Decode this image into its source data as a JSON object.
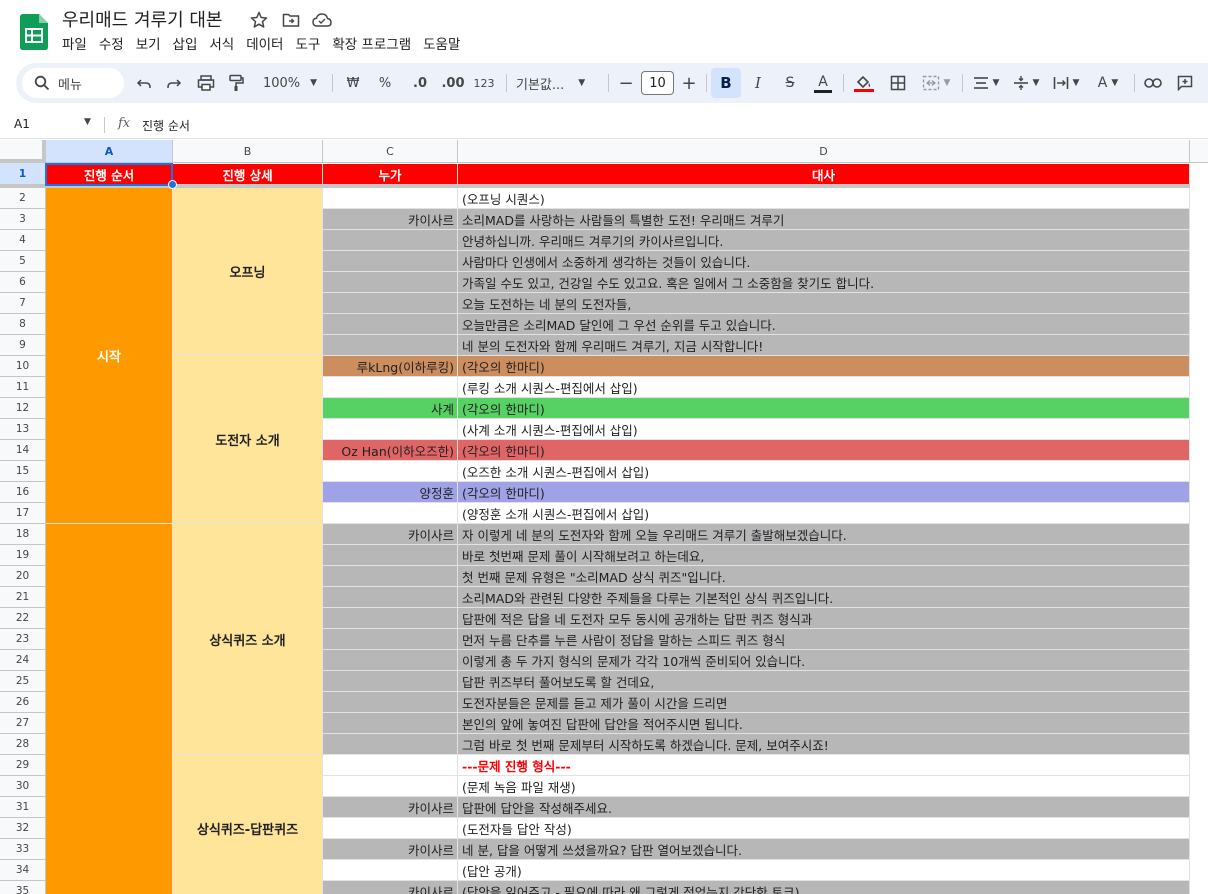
{
  "document": {
    "title": "우리매드 겨루기 대본",
    "menus": [
      "파일",
      "수정",
      "보기",
      "삽입",
      "서식",
      "데이터",
      "도구",
      "확장 프로그램",
      "도움말"
    ]
  },
  "toolbar": {
    "search_label": "메뉴",
    "zoom": "100%",
    "currency": "₩",
    "percent": "%",
    "decimal_decrease": ".0",
    "decimal_increase": ".00",
    "number_format": "123",
    "font_name": "기본값...",
    "font_size": "10",
    "bold": "B",
    "italic": "I",
    "strike": "S",
    "text_color": "A",
    "text_color_hex": "#202124",
    "fill_color_hex": "#ff0000"
  },
  "formula_bar": {
    "name_box": "A1",
    "fx": "fx",
    "content": "진행 순서"
  },
  "colors": {
    "header_red": "#ff0000",
    "section_orange": "#ff9900",
    "detail_yellow": "#ffe599",
    "gray_row": "#b7b7b7",
    "brown_row": "#cc8e5e",
    "green_row": "#57d163",
    "salmon_row": "#e06666",
    "lavender_row": "#9fa2e6",
    "selection_blue": "#1a73e8"
  },
  "sheet": {
    "columns": [
      "A",
      "B",
      "C",
      "D"
    ],
    "header_row": [
      "진행 순서",
      "진행 상세",
      "누가",
      "대사"
    ],
    "merged_a": [
      {
        "label": "시작",
        "rows": [
          2,
          17
        ]
      },
      {
        "label": "",
        "rows": [
          18,
          35
        ]
      }
    ],
    "merged_b": [
      {
        "label": "오프닝",
        "rows": [
          2,
          9
        ]
      },
      {
        "label": "도전자 소개",
        "rows": [
          10,
          17
        ]
      },
      {
        "label": "상식퀴즈 소개",
        "rows": [
          18,
          28
        ]
      },
      {
        "label": "상식퀴즈-답판퀴즈",
        "rows": [
          29,
          35
        ]
      }
    ],
    "rows": [
      {
        "n": "2",
        "who": "",
        "line": "(오프닝 시퀀스)",
        "bg": "white"
      },
      {
        "n": "3",
        "who": "카이사르",
        "line": "소리MAD를 사랑하는 사람들의 특별한 도전! 우리매드 겨루기",
        "bg": "gray"
      },
      {
        "n": "4",
        "who": "",
        "line": "안녕하십니까. 우리매드 겨루기의 카이사르입니다.",
        "bg": "gray"
      },
      {
        "n": "5",
        "who": "",
        "line": "사람마다 인생에서 소중하게 생각하는 것들이 있습니다.",
        "bg": "gray"
      },
      {
        "n": "6",
        "who": "",
        "line": "가족일 수도 있고, 건강일 수도 있고요. 혹은 일에서 그 소중함을 찾기도 합니다.",
        "bg": "gray"
      },
      {
        "n": "7",
        "who": "",
        "line": "오늘 도전하는 네 분의 도전자들,",
        "bg": "gray"
      },
      {
        "n": "8",
        "who": "",
        "line": "오늘만큼은 소리MAD 달인에 그 우선 순위를 두고 있습니다.",
        "bg": "gray"
      },
      {
        "n": "9",
        "who": "",
        "line": "네 분의 도전자와 함께 우리매드 겨루기, 지금 시작합니다!",
        "bg": "gray"
      },
      {
        "n": "10",
        "who": "루kLng(이하루킹)",
        "line": "(각오의 한마디)",
        "bg": "brown"
      },
      {
        "n": "11",
        "who": "",
        "line": "(루킹 소개 시퀀스-편집에서 삽입)",
        "bg": "white"
      },
      {
        "n": "12",
        "who": "사계",
        "line": "(각오의 한마디)",
        "bg": "green"
      },
      {
        "n": "13",
        "who": "",
        "line": "(사계 소개 시퀀스-편집에서 삽입)",
        "bg": "white"
      },
      {
        "n": "14",
        "who": "Oz Han(이하오즈한)",
        "line": "(각오의 한마디)",
        "bg": "salmon"
      },
      {
        "n": "15",
        "who": "",
        "line": "(오즈한 소개 시퀀스-편집에서 삽입)",
        "bg": "white"
      },
      {
        "n": "16",
        "who": "양정훈",
        "line": "(각오의 한마디)",
        "bg": "lavender"
      },
      {
        "n": "17",
        "who": "",
        "line": "(양정훈 소개 시퀀스-편집에서 삽입)",
        "bg": "white"
      },
      {
        "n": "18",
        "who": "카이사르",
        "line": "자 이렇게 네 분의 도전자와 함께 오늘 우리매드 겨루기 출발해보겠습니다.",
        "bg": "gray"
      },
      {
        "n": "19",
        "who": "",
        "line": "바로 첫번째 문제 풀이 시작해보려고 하는데요,",
        "bg": "gray"
      },
      {
        "n": "20",
        "who": "",
        "line": "첫 번째 문제 유형은 \"소리MAD 상식 퀴즈\"입니다.",
        "bg": "gray"
      },
      {
        "n": "21",
        "who": "",
        "line": "소리MAD와 관련된 다양한 주제들을 다루는 기본적인 상식 퀴즈입니다.",
        "bg": "gray"
      },
      {
        "n": "22",
        "who": "",
        "line": "답판에 적은 답을 네 도전자 모두 동시에 공개하는 답판 퀴즈 형식과",
        "bg": "gray"
      },
      {
        "n": "23",
        "who": "",
        "line": "먼저 누름 단추를 누른 사람이 정답을 말하는 스피드 퀴즈 형식",
        "bg": "gray"
      },
      {
        "n": "24",
        "who": "",
        "line": "이렇게 총 두 가지 형식의 문제가 각각 10개씩 준비되어 있습니다.",
        "bg": "gray"
      },
      {
        "n": "25",
        "who": "",
        "line": "답판 퀴즈부터 풀어보도록 할 건데요,",
        "bg": "gray"
      },
      {
        "n": "26",
        "who": "",
        "line": "도전자분들은 문제를 듣고 제가 풀이 시간을 드리면",
        "bg": "gray"
      },
      {
        "n": "27",
        "who": "",
        "line": "본인의 앞에 놓여진 답판에 답안을 적어주시면 됩니다.",
        "bg": "gray"
      },
      {
        "n": "28",
        "who": "",
        "line": "그럼 바로 첫 번째 문제부터 시작하도록 하겠습니다. 문제, 보여주시죠!",
        "bg": "gray"
      },
      {
        "n": "29",
        "who": "",
        "line": "---문제 진행 형식---",
        "bg": "white",
        "red": true
      },
      {
        "n": "30",
        "who": "",
        "line": "(문제 녹음 파일 재생)",
        "bg": "white"
      },
      {
        "n": "31",
        "who": "카이사르",
        "line": "답판에 답안을 작성해주세요.",
        "bg": "gray"
      },
      {
        "n": "32",
        "who": "",
        "line": "(도전자들 답안 작성)",
        "bg": "white"
      },
      {
        "n": "33",
        "who": "카이사르",
        "line": "네 분, 답을 어떻게 쓰셨을까요? 답판 열어보겠습니다.",
        "bg": "gray"
      },
      {
        "n": "34",
        "who": "",
        "line": "(답안 공개)",
        "bg": "white"
      },
      {
        "n": "35",
        "who": "카이사르",
        "line": "(답안을 읽어주고 - 필요에 따라 왜 그렇게 적었는지 간단한 토크)",
        "bg": "gray"
      }
    ]
  }
}
